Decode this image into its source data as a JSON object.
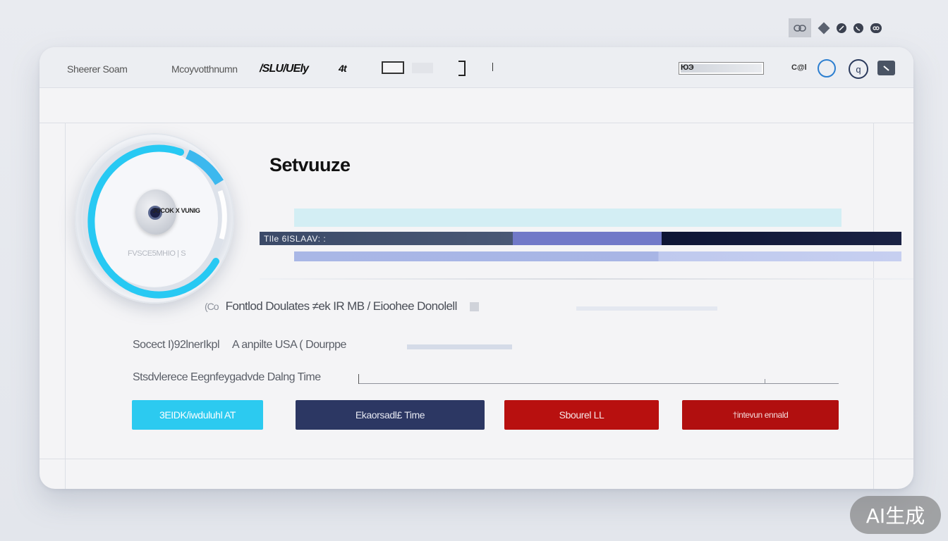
{
  "toolbar": {
    "item1": "Sheerer Soam",
    "item2": "Mcoyvotthnumn",
    "item3": "/SLU/UEly",
    "item4": "4t",
    "progress_label": "ЮЭ",
    "small_label": "C@l",
    "circle_glyph": "q"
  },
  "panel": {
    "title": "Setvuuze",
    "disk_label": "JOCOK X VUNIG",
    "disk_caption": "FVSCE5MHIO | S",
    "status_bar_label": "Tlle 6lSLAAV: :"
  },
  "details": {
    "row1_icon": "(Co",
    "row1_text": "Fontlod Doulates  ≠ek IR MB / Eioohee Donolell",
    "row2_left": "Socect I)92lnerIkpl",
    "row2_right": "A anpilte USA ( Dourppe",
    "row3_label": "Stsdvlerece  Eegnfeygadvde Dalng Time"
  },
  "buttons": {
    "b1": "3EIDK/iwduluhl AT",
    "b2": "Ekaorsadl£ Time",
    "b3": "Sbourel LL",
    "b4": "†intevun ennald"
  },
  "watermark": "AI生成",
  "colors": {
    "accent_cyan": "#2ccaf0",
    "navy": "#2c3763",
    "red": "#b8100f",
    "ring_cyan": "#27c9f3"
  }
}
